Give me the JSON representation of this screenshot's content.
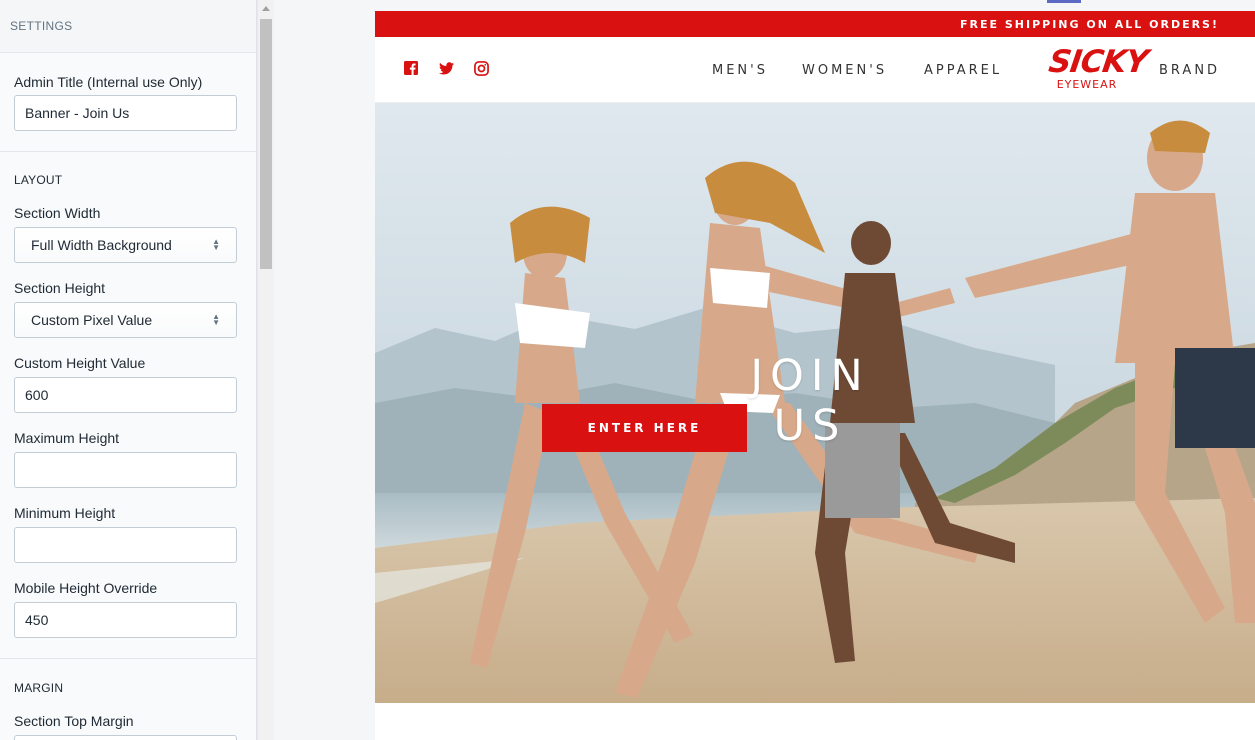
{
  "settings": {
    "header": "SETTINGS",
    "admin_title": {
      "label": "Admin Title (Internal use Only)",
      "value": "Banner - Join Us"
    },
    "layout": {
      "heading": "LAYOUT",
      "section_width": {
        "label": "Section Width",
        "value": "Full Width Background"
      },
      "section_height": {
        "label": "Section Height",
        "value": "Custom Pixel Value"
      },
      "custom_height": {
        "label": "Custom Height Value",
        "value": "600"
      },
      "max_height": {
        "label": "Maximum Height",
        "value": ""
      },
      "min_height": {
        "label": "Minimum Height",
        "value": ""
      },
      "mobile_height": {
        "label": "Mobile Height Override",
        "value": "450"
      }
    },
    "margin": {
      "heading": "MARGIN",
      "top_margin": {
        "label": "Section Top Margin"
      }
    }
  },
  "site": {
    "announcement": "FREE SHIPPING ON ALL ORDERS!",
    "social_icons": [
      "facebook-icon",
      "twitter-icon",
      "instagram-icon"
    ],
    "nav": {
      "mens": "MEN'S",
      "womens": "WOMEN'S",
      "apparel": "APPAREL",
      "brand": "BRAND"
    },
    "logo": {
      "word": "SICKY",
      "sub": "EYEWEAR"
    },
    "hero": {
      "title": "JOIN US",
      "button": "ENTER HERE"
    },
    "colors": {
      "brand_red": "#d91111",
      "accent": "#5c6ac4"
    }
  }
}
